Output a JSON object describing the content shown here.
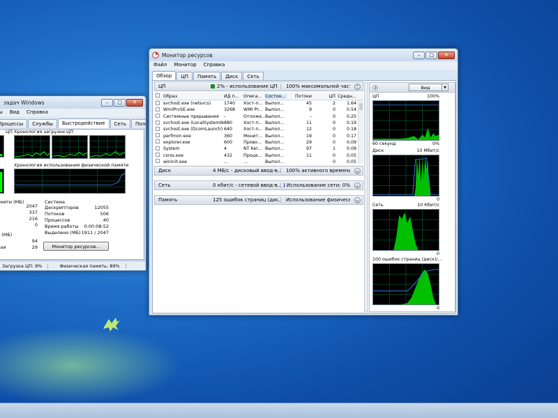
{
  "colors": {
    "accent": "#00ff00",
    "graph_bg": "#000000",
    "gridline": "#008040",
    "blue_line": "#3a7bd5"
  },
  "task_manager": {
    "title": "задач Windows",
    "menu": [
      "мы",
      "Вид",
      "Справка"
    ],
    "tabs": [
      "Процессы",
      "Службы",
      "Быстродействие",
      "Сеть",
      "Пользователи"
    ],
    "active_tab": "Быстродействие",
    "cpu_label": "ЦП",
    "cpu_history_label": "Хронология загрузки ЦП",
    "mem_history_label": "Хронология использования физической памяти",
    "phys_mem_title": "памяти (МБ)",
    "phys_mem_values": [
      {
        "label": "",
        "value": "2047"
      },
      {
        "label": "но",
        "value": "337"
      },
      {
        "label": "",
        "value": "216"
      },
      {
        "label": "",
        "value": "0"
      }
    ],
    "kernel_title": "ра (МБ)",
    "kernel_values": [
      {
        "label": "ая",
        "value": "94"
      },
      {
        "label": "ямая",
        "value": "29"
      }
    ],
    "system_title": "Система",
    "system_values": [
      {
        "label": "Дескрипторов",
        "value": "12055"
      },
      {
        "label": "Потоков",
        "value": "506"
      },
      {
        "label": "Процессов",
        "value": "40"
      },
      {
        "label": "Время работы",
        "value": "0:00:08:52"
      },
      {
        "label": "Выделено (МБ)",
        "value": "1911 / 2047"
      }
    ],
    "resmon_button": "Монитор ресурсов...",
    "status": [
      "Загрузка ЦП: 9%",
      "Физическая память: 89%"
    ]
  },
  "resource_monitor": {
    "title": "Монитор ресурсов",
    "menu": [
      "Файл",
      "Монитор",
      "Справка"
    ],
    "tabs": [
      "Обзор",
      "ЦП",
      "Память",
      "Диск",
      "Сеть"
    ],
    "active_tab": "Обзор",
    "sections": {
      "cpu": {
        "name": "ЦП",
        "stat1": "2% - использование ЦП",
        "stat2": "100% максимальной част...",
        "color1": "#1e8a1e",
        "color2": "#4f8fd6"
      },
      "disk": {
        "name": "Диск",
        "stat1": "4 МБ/с - дисковый ввод-в...",
        "stat2": "100% активного времени ...",
        "color1": "#1e8a1e",
        "color2": "#4f8fd6"
      },
      "net": {
        "name": "Сеть",
        "stat1": "0 кбит/с - сетевой ввод-в...",
        "stat2": "Использование сети: 0%",
        "color1": "#1e8a1e",
        "color2": "#1a3fa8"
      },
      "mem": {
        "name": "Память",
        "stat1": "125 ошибок страниц (дис...",
        "stat2": "Использование физическ...",
        "color1": "#2fd02f",
        "color2": "#4f8fd6"
      }
    },
    "process_headers": [
      "Образ",
      "ИД п...",
      "Описа...",
      "Состоя...",
      "Потоки",
      "ЦП",
      "Средн..."
    ],
    "processes": [
      [
        "svchost.exe (netsvcs)",
        "1740",
        "Хост-п...",
        "Выпол...",
        "45",
        "2",
        "1.64"
      ],
      [
        "WmiPrvSE.exe",
        "3268",
        "WMI Pr...",
        "Выпол...",
        "9",
        "0",
        "0.54"
      ],
      [
        "Системные прерывания",
        "-",
        "Отложе...",
        "Выпол...",
        "-",
        "0",
        "0.25"
      ],
      [
        "svchost.exe (LocalSystemNet...",
        "880",
        "Хост-п...",
        "Выпол...",
        "11",
        "0",
        "0.19"
      ],
      [
        "svchost.exe (DcomLaunch)",
        "640",
        "Хост-п...",
        "Выпол...",
        "12",
        "0",
        "0.18"
      ],
      [
        "perfmon.exe",
        "360",
        "Монит...",
        "Выпол...",
        "19",
        "0",
        "0.17"
      ],
      [
        "explorer.exe",
        "600",
        "Прово...",
        "Выпол...",
        "29",
        "0",
        "0.09"
      ],
      [
        "System",
        "4",
        "NT Ker...",
        "Выпол...",
        "97",
        "1",
        "0.09"
      ],
      [
        "csrss.exe",
        "432",
        "Проце...",
        "Выпол...",
        "11",
        "0",
        "0.05"
      ],
      [
        "wininit.exe",
        "...",
        "...",
        "Выпол...",
        "",
        "0",
        "0.05"
      ]
    ],
    "view_button": "Вид",
    "graphs": [
      {
        "label": "ЦП",
        "right": "100%",
        "bottom_left": "60 секунд",
        "bottom_right": "0%"
      },
      {
        "label": "Диск",
        "right": "10 Мбит/с",
        "bottom_left": "",
        "bottom_right": "0"
      },
      {
        "label": "Сеть",
        "right": "10 Кбит/с",
        "bottom_left": "",
        "bottom_right": "0"
      },
      {
        "label": "100 ошибок страниц (диск)/...",
        "right": "",
        "bottom_left": "",
        "bottom_right": "0"
      }
    ]
  }
}
